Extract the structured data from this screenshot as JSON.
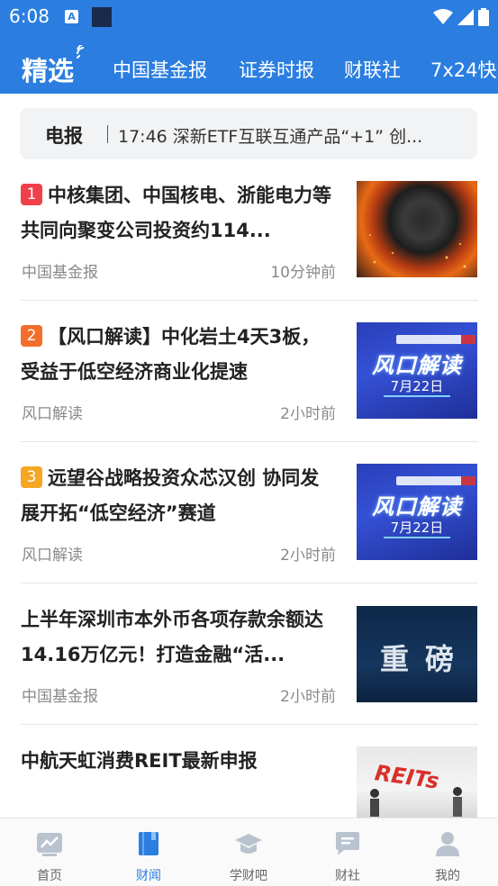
{
  "status_bar": {
    "time": "6:08",
    "notif_icon_letter": "A"
  },
  "tabs": {
    "active": "精选",
    "items": [
      "中国基金报",
      "证券时报",
      "财联社",
      "7x24快"
    ]
  },
  "telegraph": {
    "label": "电报",
    "text": "17:46 深新ETF互联互通产品“+1” 创..."
  },
  "articles": [
    {
      "rank": "1",
      "rank_color": "#f0404a",
      "title": "中核集团、中国核电、浙能电力等共同向聚变公司投资约114...",
      "source": "中国基金报",
      "time": "10分钟前",
      "thumb": "fire"
    },
    {
      "rank": "2",
      "rank_color": "#f46d2b",
      "title": "【风口解读】中化岩土4天3板，受益于低空经济商业化提速",
      "source": "风口解读",
      "time": "2小时前",
      "thumb": "blue",
      "thumb_title": "风口解读",
      "thumb_date": "7月22日"
    },
    {
      "rank": "3",
      "rank_color": "#f5a623",
      "title": "远望谷战略投资众芯汉创 协同发展开拓“低空经济”赛道",
      "source": "风口解读",
      "time": "2小时前",
      "thumb": "blue",
      "thumb_title": "风口解读",
      "thumb_date": "7月22日"
    },
    {
      "rank": "",
      "title": "上半年深圳市本外币各项存款余额达14.16万亿元！打造金融“活...",
      "source": "中国基金报",
      "time": "2小时前",
      "thumb": "zb",
      "thumb_title": "重磅"
    },
    {
      "rank": "",
      "title": "中航天虹消费REIT最新申报",
      "source": "",
      "time": "",
      "thumb": "reit",
      "thumb_title": "REITs"
    }
  ],
  "bottom_nav": [
    {
      "label": "首页",
      "icon": "chart-icon",
      "active": false
    },
    {
      "label": "财闻",
      "icon": "book-icon",
      "active": true
    },
    {
      "label": "学财吧",
      "icon": "graduation-cap-icon",
      "active": false
    },
    {
      "label": "财社",
      "icon": "chat-icon",
      "active": false
    },
    {
      "label": "我的",
      "icon": "user-icon",
      "active": false
    }
  ],
  "colors": {
    "primary": "#2b7ee0",
    "active_nav": "#2b7ee0"
  }
}
